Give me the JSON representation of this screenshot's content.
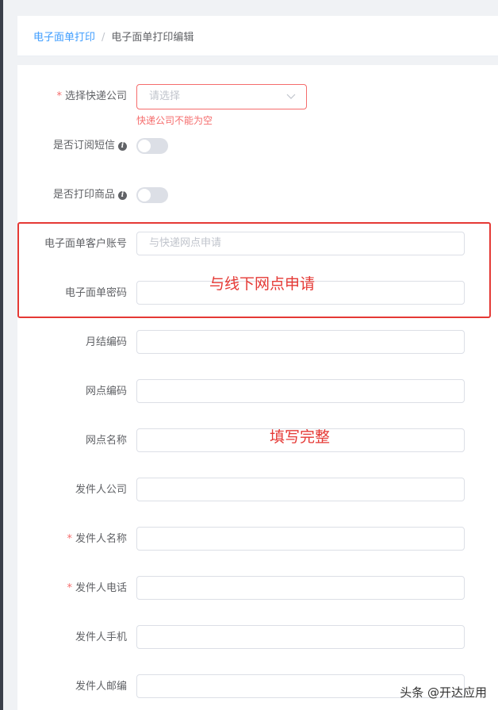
{
  "breadcrumb": {
    "parent": "电子面单打印",
    "separator": "/",
    "current": "电子面单打印编辑"
  },
  "form": {
    "express_company": {
      "label": "选择快递公司",
      "required": true,
      "placeholder": "请选择",
      "error": "快递公司不能为空"
    },
    "sms_subscribe": {
      "label": "是否订阅短信",
      "enabled": false
    },
    "print_goods": {
      "label": "是否打印商品",
      "enabled": false
    },
    "customer_account": {
      "label": "电子面单客户账号",
      "placeholder": "与快递网点申请",
      "value": ""
    },
    "password": {
      "label": "电子面单密码",
      "value": ""
    },
    "monthly_code": {
      "label": "月结编码",
      "value": ""
    },
    "branch_code": {
      "label": "网点编码",
      "value": ""
    },
    "branch_name": {
      "label": "网点名称",
      "value": ""
    },
    "sender_company": {
      "label": "发件人公司",
      "value": ""
    },
    "sender_name": {
      "label": "发件人名称",
      "required": true,
      "value": ""
    },
    "sender_phone": {
      "label": "发件人电话",
      "required": true,
      "value": ""
    },
    "sender_mobile": {
      "label": "发件人手机",
      "value": ""
    },
    "sender_zip": {
      "label": "发件人邮编",
      "value": ""
    }
  },
  "annotations": {
    "box_note": "与线下网点申请",
    "fill_note": "填写完整",
    "color": "#e53935"
  },
  "watermark": "头条 @开达应用",
  "colors": {
    "accent": "#409eff",
    "error": "#f56c6c"
  }
}
